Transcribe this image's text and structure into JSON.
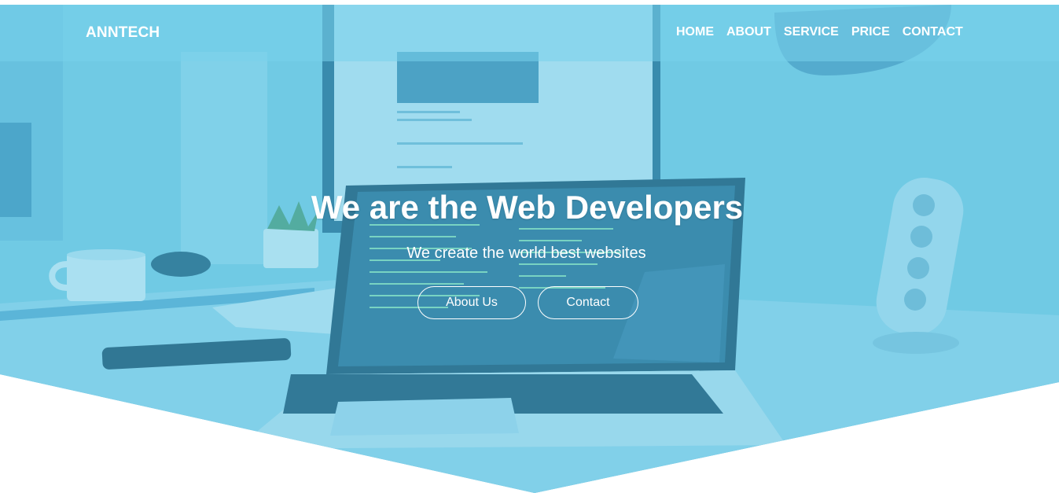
{
  "header": {
    "brand": "ANNTECH",
    "nav": [
      "HOME",
      "ABOUT",
      "SERVICE",
      "PRICE",
      "CONTACT"
    ]
  },
  "hero": {
    "title": "We are the Web Developers",
    "subtitle": "We create the world best websites",
    "buttons": {
      "about": "About Us",
      "contact": "Contact"
    }
  },
  "colors": {
    "overlay": "#5ec3e3",
    "text": "#ffffff",
    "background": "#ffffff"
  }
}
